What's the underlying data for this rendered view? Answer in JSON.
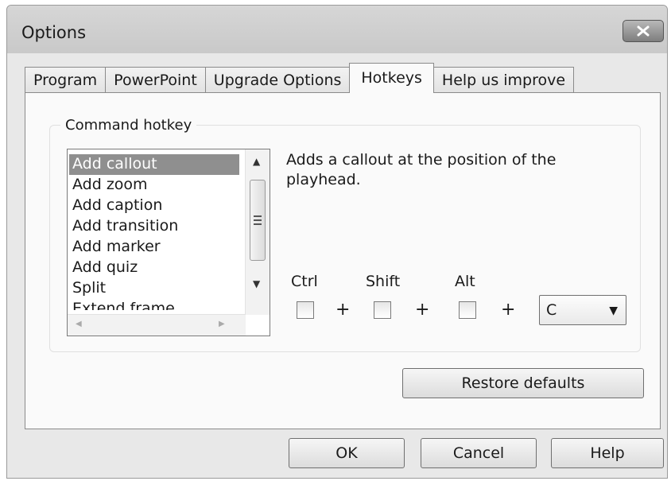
{
  "window": {
    "title": "Options"
  },
  "tabs": [
    {
      "label": "Program"
    },
    {
      "label": "PowerPoint"
    },
    {
      "label": "Upgrade Options"
    },
    {
      "label": "Hotkeys",
      "active": true
    },
    {
      "label": "Help us improve"
    }
  ],
  "hotkey_group": {
    "label": "Command hotkey",
    "commands": [
      "Add callout",
      "Add zoom",
      "Add caption",
      "Add transition",
      "Add marker",
      "Add quiz",
      "Split",
      "Extend frame"
    ],
    "selected_index": 0,
    "description": "Adds a callout at the position of the playhead.",
    "modifiers": {
      "ctrl": "Ctrl",
      "shift": "Shift",
      "alt": "Alt"
    },
    "plus": "+",
    "key_value": "C"
  },
  "buttons": {
    "restore": "Restore defaults",
    "ok": "OK",
    "cancel": "Cancel",
    "help": "Help"
  },
  "icons": {
    "close": "close-icon",
    "scroll_up": "chevron-up-icon",
    "scroll_down": "chevron-down-icon",
    "scroll_left": "chevron-left-icon",
    "scroll_right": "chevron-right-icon",
    "dropdown": "chevron-down-icon"
  }
}
